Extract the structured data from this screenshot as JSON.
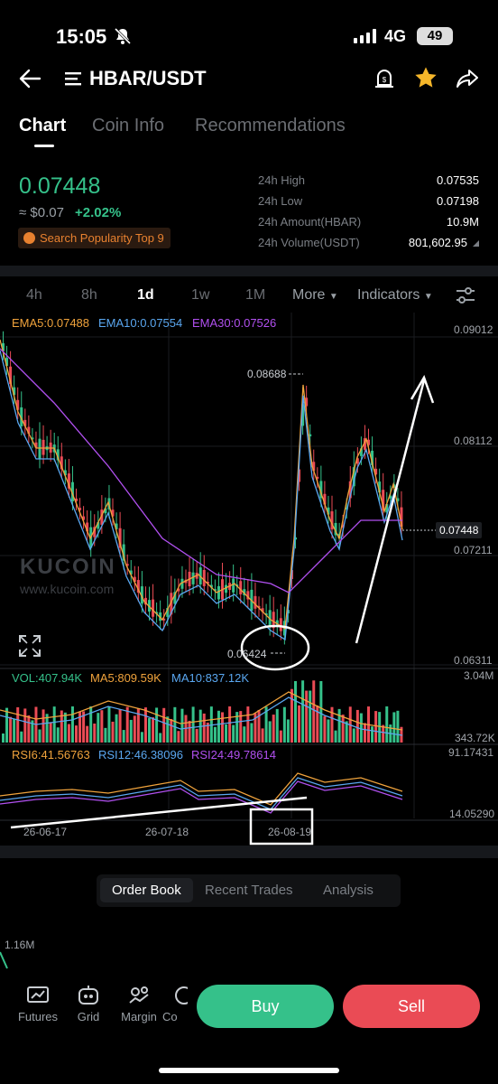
{
  "status": {
    "time": "15:05",
    "network": "4G",
    "battery": "49"
  },
  "header": {
    "pair": "HBAR/USDT"
  },
  "tabs": [
    "Chart",
    "Coin Info",
    "Recommendations"
  ],
  "ticker": {
    "last_price": "0.07448",
    "usd_price": "≈ $0.07",
    "change": "+2.02%",
    "popularity": "Search Popularity Top 9",
    "stats": [
      {
        "label": "24h High",
        "value": "0.07535"
      },
      {
        "label": "24h Low",
        "value": "0.07198"
      },
      {
        "label": "24h Amount(HBAR)",
        "value": "10.9M"
      },
      {
        "label": "24h Volume(USDT)",
        "value": "801,602.95"
      }
    ]
  },
  "timeframes": {
    "items": [
      "4h",
      "8h",
      "1d",
      "1w",
      "1M"
    ],
    "active": "1d",
    "more": "More",
    "indicators": "Indicators"
  },
  "chart": {
    "ema5": "EMA5:0.07488",
    "ema10": "EMA10:0.07554",
    "ema30": "EMA30:0.07526",
    "price_axis": [
      "0.09012",
      "0.08112",
      "0.07211",
      "0.06311"
    ],
    "current_price_tag": "0.07448",
    "high_marker": "0.08688",
    "low_marker": "0.06424",
    "watermark": "KUCOIN",
    "watermark_url": "www.kucoin.com",
    "vol": "VOL:407.94K",
    "vol_ma5": "MA5:809.59K",
    "vol_ma10": "MA10:837.12K",
    "vol_axis": [
      "3.04M",
      "343.72K"
    ],
    "rsi6": "RSI6:41.56763",
    "rsi12": "RSI12:46.38096",
    "rsi24": "RSI24:49.78614",
    "rsi_axis": [
      "91.17431",
      "14.05290"
    ],
    "dates": [
      "26-06-17",
      "26-07-18",
      "26-08-19"
    ]
  },
  "bottom_tabs": [
    "Order Book",
    "Recent Trades",
    "Analysis"
  ],
  "depth_label": "1.16M",
  "footer": {
    "items": [
      "Futures",
      "Grid",
      "Margin",
      "Co"
    ],
    "buy": "Buy",
    "sell": "Sell"
  },
  "colors": {
    "up": "#35c18a",
    "down": "#ea4b55",
    "ema5": "#f0a33c",
    "ema10": "#5aa7f0",
    "ema30": "#b150f0"
  }
}
